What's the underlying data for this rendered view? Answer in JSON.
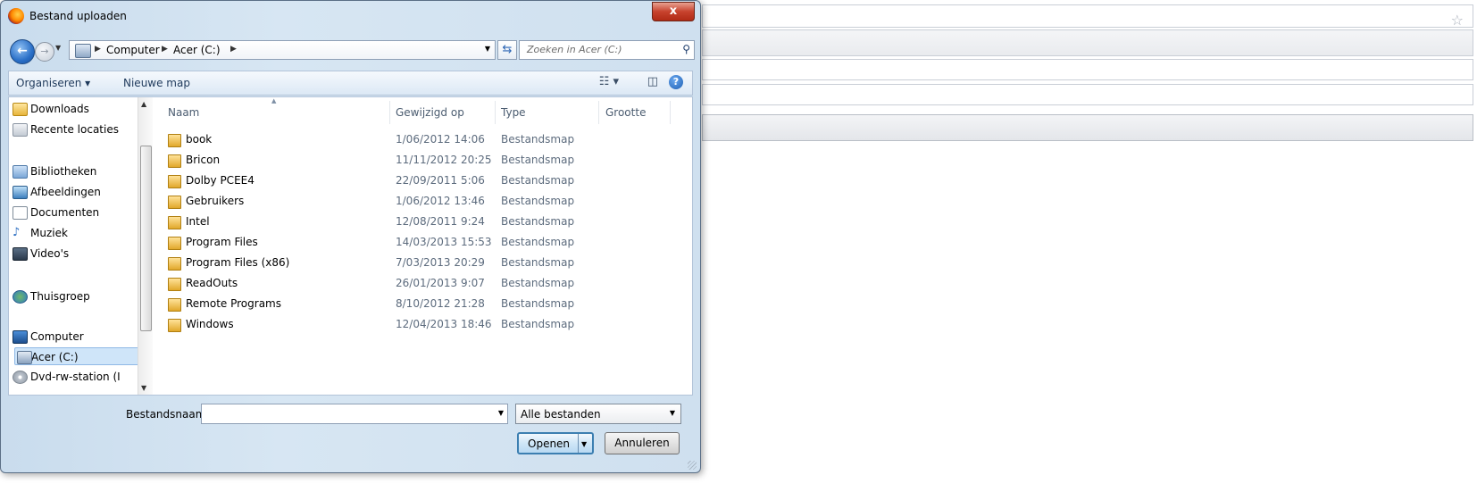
{
  "dialog": {
    "title": "Bestand uploaden",
    "close_label": "x"
  },
  "address": {
    "crumbs": [
      "Computer",
      "Acer (C:)"
    ],
    "search_placeholder": "Zoeken in Acer (C:)"
  },
  "toolbar": {
    "organize_label": "Organiseren ▾",
    "new_folder_label": "Nieuwe map"
  },
  "sidebar": {
    "items": [
      {
        "label": "Downloads",
        "icon": "downloads-folder-icon"
      },
      {
        "label": "Recente locaties",
        "icon": "recent-places-icon"
      },
      {
        "label": "Bibliotheken",
        "icon": "libraries-icon"
      },
      {
        "label": "Afbeeldingen",
        "icon": "pictures-icon"
      },
      {
        "label": "Documenten",
        "icon": "documents-icon"
      },
      {
        "label": "Muziek",
        "icon": "music-icon"
      },
      {
        "label": "Video's",
        "icon": "videos-icon"
      },
      {
        "label": "Thuisgroep",
        "icon": "homegroup-icon"
      },
      {
        "label": "Computer",
        "icon": "computer-icon"
      },
      {
        "label": "Acer (C:)",
        "icon": "drive-icon",
        "selected": true
      },
      {
        "label": "Dvd-rw-station (I",
        "icon": "dvd-drive-icon"
      }
    ]
  },
  "filelist": {
    "columns": [
      "Naam",
      "Gewijzigd op",
      "Type",
      "Grootte"
    ],
    "rows": [
      {
        "name": "book",
        "modified": "1/06/2012 14:06",
        "type": "Bestandsmap"
      },
      {
        "name": "Bricon",
        "modified": "11/11/2012 20:25",
        "type": "Bestandsmap"
      },
      {
        "name": "Dolby PCEE4",
        "modified": "22/09/2011 5:06",
        "type": "Bestandsmap"
      },
      {
        "name": "Gebruikers",
        "modified": "1/06/2012 13:46",
        "type": "Bestandsmap"
      },
      {
        "name": "Intel",
        "modified": "12/08/2011 9:24",
        "type": "Bestandsmap"
      },
      {
        "name": "Program Files",
        "modified": "14/03/2013 15:53",
        "type": "Bestandsmap"
      },
      {
        "name": "Program Files (x86)",
        "modified": "7/03/2013 20:29",
        "type": "Bestandsmap"
      },
      {
        "name": "ReadOuts",
        "modified": "26/01/2013 9:07",
        "type": "Bestandsmap"
      },
      {
        "name": "Remote Programs",
        "modified": "8/10/2012 21:28",
        "type": "Bestandsmap"
      },
      {
        "name": "Windows",
        "modified": "12/04/2013 18:46",
        "type": "Bestandsmap"
      }
    ]
  },
  "footer": {
    "filename_label": "Bestandsnaam:",
    "filename_value": "",
    "filetype_value": "Alle bestanden",
    "open_label": "Openen",
    "cancel_label": "Annuleren"
  }
}
